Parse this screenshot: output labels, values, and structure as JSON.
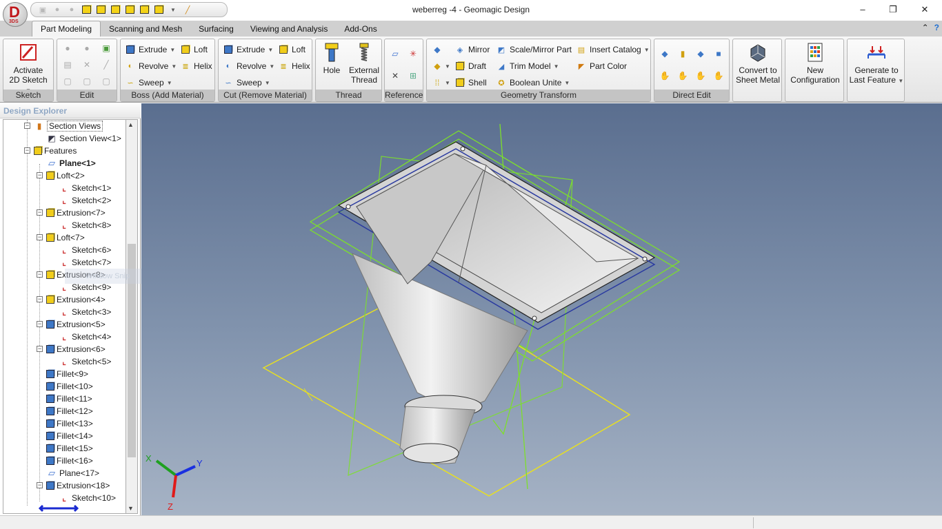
{
  "window": {
    "title": "weberreg -4 - Geomagic Design",
    "logo_letter": "D",
    "logo_sub": "3DS",
    "controls": [
      "–",
      "❐",
      "✕"
    ]
  },
  "tabs": [
    {
      "label": "Part Modeling",
      "active": true
    },
    {
      "label": "Scanning and Mesh"
    },
    {
      "label": "Surfacing"
    },
    {
      "label": "Viewing and Analysis"
    },
    {
      "label": "Add-Ons"
    }
  ],
  "ribbon": {
    "sketch": {
      "label": "Sketch",
      "activate": "Activate",
      "activate2": "2D Sketch"
    },
    "edit": {
      "label": "Edit"
    },
    "boss": {
      "label": "Boss (Add Material)",
      "extrude": "Extrude",
      "loft": "Loft",
      "revolve": "Revolve",
      "helix": "Helix",
      "sweep": "Sweep"
    },
    "cut": {
      "label": "Cut (Remove Material)",
      "extrude": "Extrude",
      "loft": "Loft",
      "revolve": "Revolve",
      "helix": "Helix",
      "sweep": "Sweep"
    },
    "thread": {
      "label": "Thread",
      "hole": "Hole",
      "external": "External",
      "external2": "Thread"
    },
    "reference": {
      "label": "Reference"
    },
    "geometry": {
      "label": "Geometry Transform",
      "mirror": "Mirror",
      "scale": "Scale/Mirror Part",
      "insert": "Insert Catalog",
      "draft": "Draft",
      "trim": "Trim Model",
      "color": "Part Color",
      "shell": "Shell",
      "boolean": "Boolean Unite"
    },
    "direct": {
      "label": "Direct Edit"
    },
    "sheet": {
      "l1": "Convert to",
      "l2": "Sheet Metal"
    },
    "config": {
      "l1": "New",
      "l2": "Configuration"
    },
    "generate": {
      "l1": "Generate to",
      "l2": "Last Feature"
    }
  },
  "explorer": {
    "title": "Design Explorer",
    "watermark": "Window Snip",
    "items": [
      {
        "label": "Section Views",
        "icon": "folder",
        "level": 0,
        "toggle": "−"
      },
      {
        "label": "Section View<1>",
        "icon": "section",
        "level": 1
      },
      {
        "label": "Features",
        "icon": "cube",
        "level": 0,
        "toggle": "−"
      },
      {
        "label": "Plane<1>",
        "icon": "plane",
        "level": 1,
        "bold": true
      },
      {
        "label": "Loft<2>",
        "icon": "cube",
        "level": 1,
        "toggle": "−"
      },
      {
        "label": "Sketch<1>",
        "icon": "sketch",
        "level": 2
      },
      {
        "label": "Sketch<2>",
        "icon": "sketch",
        "level": 2
      },
      {
        "label": "Extrusion<7>",
        "icon": "cube",
        "level": 1,
        "toggle": "−"
      },
      {
        "label": "Sketch<8>",
        "icon": "sketch",
        "level": 2
      },
      {
        "label": "Loft<7>",
        "icon": "cube",
        "level": 1,
        "toggle": "−"
      },
      {
        "label": "Sketch<6>",
        "icon": "sketch",
        "level": 2
      },
      {
        "label": "Sketch<7>",
        "icon": "sketch",
        "level": 2
      },
      {
        "label": "Extrusion<8>",
        "icon": "cube",
        "level": 1,
        "toggle": "−"
      },
      {
        "label": "Sketch<9>",
        "icon": "sketch",
        "level": 2
      },
      {
        "label": "Extrusion<4>",
        "icon": "cube",
        "level": 1,
        "toggle": "−"
      },
      {
        "label": "Sketch<3>",
        "icon": "sketch",
        "level": 2
      },
      {
        "label": "Extrusion<5>",
        "icon": "cubeblue",
        "level": 1,
        "toggle": "−"
      },
      {
        "label": "Sketch<4>",
        "icon": "sketch",
        "level": 2
      },
      {
        "label": "Extrusion<6>",
        "icon": "cubeblue",
        "level": 1,
        "toggle": "−"
      },
      {
        "label": "Sketch<5>",
        "icon": "sketch",
        "level": 2
      },
      {
        "label": "Fillet<9>",
        "icon": "cubeblue",
        "level": 1
      },
      {
        "label": "Fillet<10>",
        "icon": "cubeblue",
        "level": 1
      },
      {
        "label": "Fillet<11>",
        "icon": "cubeblue",
        "level": 1
      },
      {
        "label": "Fillet<12>",
        "icon": "cubeblue",
        "level": 1
      },
      {
        "label": "Fillet<13>",
        "icon": "cubeblue",
        "level": 1
      },
      {
        "label": "Fillet<14>",
        "icon": "cubeblue",
        "level": 1
      },
      {
        "label": "Fillet<15>",
        "icon": "cubeblue",
        "level": 1
      },
      {
        "label": "Fillet<16>",
        "icon": "cubeblue",
        "level": 1
      },
      {
        "label": "Plane<17>",
        "icon": "plane",
        "level": 1
      },
      {
        "label": "Extrusion<18>",
        "icon": "cubeblue",
        "level": 1,
        "toggle": "−"
      },
      {
        "label": "Sketch<10>",
        "icon": "sketch",
        "level": 2
      }
    ]
  },
  "triad": {
    "x": "X",
    "y": "Y",
    "z": "Z"
  },
  "colors": {
    "ribbon_label_bg": "#c4c4c4",
    "viewport_top": "#5a6e8f",
    "viewport_bottom": "#a6b3c5",
    "green_plane": "#7de02a",
    "yellow_plane": "#e8e020"
  }
}
